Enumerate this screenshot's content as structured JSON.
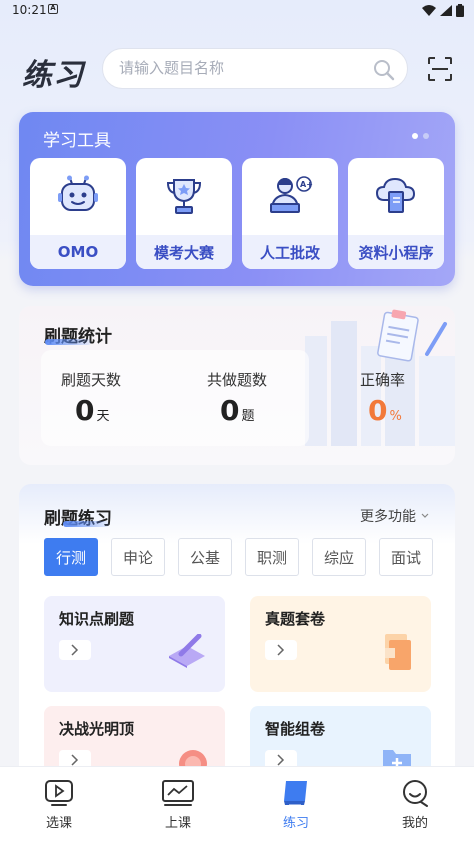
{
  "status_bar": {
    "time": "10:21",
    "notification_badge": "A"
  },
  "header": {
    "title": "练习",
    "search_placeholder": "请输入题目名称"
  },
  "tools": {
    "title": "学习工具",
    "items": [
      {
        "label": "OMO",
        "icon": "robot-icon"
      },
      {
        "label": "模考大赛",
        "icon": "trophy-icon"
      },
      {
        "label": "人工批改",
        "icon": "teacher-icon"
      },
      {
        "label": "资料小程序",
        "icon": "cloud-book-icon"
      }
    ]
  },
  "stats": {
    "title": "刷题统计",
    "days": {
      "label": "刷题天数",
      "value": "0",
      "unit": "天"
    },
    "total": {
      "label": "共做题数",
      "value": "0",
      "unit": "题"
    },
    "accuracy": {
      "label": "正确率",
      "value": "0",
      "unit": "%"
    }
  },
  "practice": {
    "title": "刷题练习",
    "more_label": "更多功能",
    "tabs": [
      "行测",
      "申论",
      "公基",
      "职测",
      "综应",
      "面试"
    ],
    "tiles": [
      {
        "title": "知识点刷题"
      },
      {
        "title": "真题套卷"
      },
      {
        "title": "决战光明顶"
      },
      {
        "title": "智能组卷"
      }
    ]
  },
  "nav": {
    "items": [
      {
        "label": "选课"
      },
      {
        "label": "上课"
      },
      {
        "label": "练习"
      },
      {
        "label": "我的"
      }
    ]
  },
  "colors": {
    "accent": "#3e7cf0",
    "tools_gradient_start": "#6f88f2",
    "accuracy": "#f2793a"
  }
}
